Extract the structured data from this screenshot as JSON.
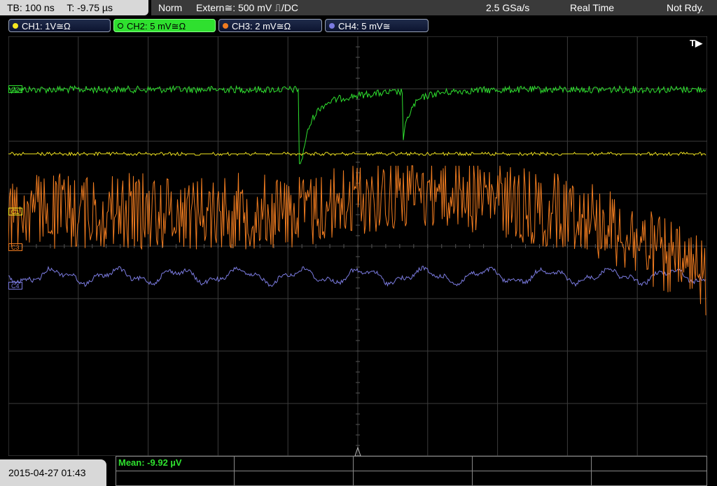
{
  "status": {
    "timebase": "TB: 100 ns",
    "trigger_time": "T: -9.75 µs",
    "trigger_mode": "Norm",
    "trigger_source": "Extern≅: 500 mV ⎍/DC",
    "sample_rate": "2.5 GSa/s",
    "acquisition": "Real Time",
    "state": "Not Rdy."
  },
  "channels": [
    {
      "label": "CH1: 1V≅Ω",
      "color": "#f5e820",
      "active": false
    },
    {
      "label": "CH2: 5 mV≅Ω",
      "color": "#2fe02f",
      "active": true
    },
    {
      "label": "CH3: 2 mV≅Ω",
      "color": "#f07c20",
      "active": false
    },
    {
      "label": "CH4: 5 mV≅",
      "color": "#7b7be0",
      "active": false
    }
  ],
  "markers": {
    "c2": "C2",
    "c1": "C1",
    "c3": "C3",
    "c4": "C4",
    "trigger": "T▶"
  },
  "footer": {
    "datetime": "2015-04-27 01:43",
    "mean": "Mean: -9.92 µV"
  },
  "colors": {
    "grid": "#3c3c3c",
    "background": "#000000"
  }
}
